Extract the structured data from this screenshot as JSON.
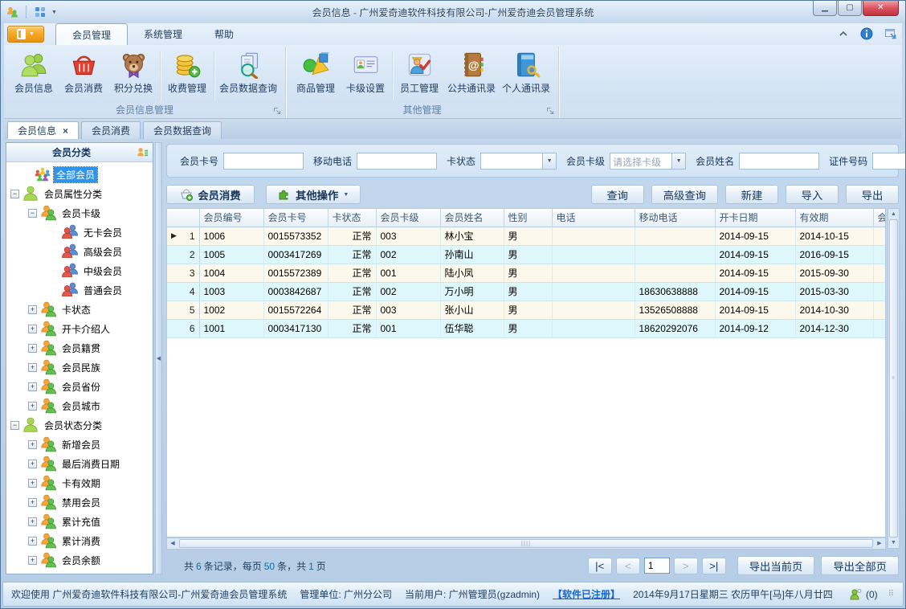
{
  "window": {
    "title": "会员信息 - 广州爱奇迪软件科技有限公司-广州爱奇迪会员管理系统"
  },
  "ribbon": {
    "tabs": [
      {
        "label": "会员管理"
      },
      {
        "label": "系统管理"
      },
      {
        "label": "帮助"
      }
    ],
    "groups": [
      {
        "label": "会员信息管理",
        "buttons": [
          {
            "label": "会员信息",
            "icon": "members-icon"
          },
          {
            "label": "会员消费",
            "icon": "basket-icon"
          },
          {
            "label": "积分兑换",
            "icon": "teddy-bear-icon"
          },
          {
            "label": "收费管理",
            "icon": "coins-add-icon"
          },
          {
            "label": "会员数据查询",
            "icon": "document-search-icon"
          }
        ]
      },
      {
        "label": "其他管理",
        "buttons": [
          {
            "label": "商品管理",
            "icon": "shapes-icon"
          },
          {
            "label": "卡级设置",
            "icon": "id-card-icon"
          },
          {
            "label": "员工管理",
            "icon": "staff-check-icon"
          },
          {
            "label": "公共通讯录",
            "icon": "address-book-icon"
          },
          {
            "label": "个人通讯录",
            "icon": "book-key-icon"
          }
        ]
      }
    ]
  },
  "doc_tabs": [
    {
      "label": "会员信息",
      "active": true
    },
    {
      "label": "会员消费"
    },
    {
      "label": "会员数据查询"
    }
  ],
  "sidebar": {
    "header": "会员分类",
    "tree": [
      {
        "label": "全部会员",
        "selected": true
      },
      {
        "label": "会员属性分类"
      },
      {
        "label": "会员卡级"
      },
      {
        "label": "无卡会员"
      },
      {
        "label": "高级会员"
      },
      {
        "label": "中级会员"
      },
      {
        "label": "普通会员"
      },
      {
        "label": "卡状态"
      },
      {
        "label": "开卡介绍人"
      },
      {
        "label": "会员籍贯"
      },
      {
        "label": "会员民族"
      },
      {
        "label": "会员省份"
      },
      {
        "label": "会员城市"
      },
      {
        "label": "会员状态分类"
      },
      {
        "label": "新增会员"
      },
      {
        "label": "最后消费日期"
      },
      {
        "label": "卡有效期"
      },
      {
        "label": "禁用会员"
      },
      {
        "label": "累计充值"
      },
      {
        "label": "累计消费"
      },
      {
        "label": "会员余额"
      }
    ]
  },
  "filters": {
    "card_no_label": "会员卡号",
    "mobile_label": "移动电话",
    "card_status_label": "卡状态",
    "card_level_label": "会员卡级",
    "card_level_placeholder": "请选择卡级",
    "name_label": "会员姓名",
    "id_no_label": "证件号码"
  },
  "actions": {
    "member_consume": "会员消费",
    "other_ops": "其他操作",
    "query": "查询",
    "advanced_query": "高级查询",
    "create": "新建",
    "import": "导入",
    "export": "导出"
  },
  "table": {
    "headers": [
      "",
      "会员编号",
      "会员卡号",
      "卡状态",
      "会员卡级",
      "会员姓名",
      "性别",
      "电话",
      "移动电话",
      "开卡日期",
      "有效期",
      "会员"
    ],
    "rows": [
      {
        "num": "1",
        "cells": [
          "1006",
          "0015573352",
          "正常",
          "003",
          "林小宝",
          "男",
          "",
          "",
          "2014-09-15",
          "2014-10-15",
          ""
        ]
      },
      {
        "num": "2",
        "cells": [
          "1005",
          "0003417269",
          "正常",
          "002",
          "孙南山",
          "男",
          "",
          "",
          "2014-09-15",
          "2016-09-15",
          ""
        ]
      },
      {
        "num": "3",
        "cells": [
          "1004",
          "0015572389",
          "正常",
          "001",
          "陆小凤",
          "男",
          "",
          "",
          "2014-09-15",
          "2015-09-30",
          ""
        ]
      },
      {
        "num": "4",
        "cells": [
          "1003",
          "0003842687",
          "正常",
          "002",
          "万小明",
          "男",
          "",
          "18630638888",
          "2014-09-15",
          "2015-03-30",
          ""
        ]
      },
      {
        "num": "5",
        "cells": [
          "1002",
          "0015572264",
          "正常",
          "003",
          "张小山",
          "男",
          "",
          "13526508888",
          "2014-09-15",
          "2014-10-30",
          ""
        ]
      },
      {
        "num": "6",
        "cells": [
          "1001",
          "0003417130",
          "正常",
          "001",
          "伍华聪",
          "男",
          "",
          "18620292076",
          "2014-09-12",
          "2014-12-30",
          ""
        ]
      }
    ]
  },
  "pager": {
    "summary": {
      "p1": "共",
      "count": "6",
      "p2": "条记录，每页",
      "size": "50",
      "p3": "条，共",
      "pages": "1",
      "p4": "页"
    },
    "first": "|<",
    "prev": "<",
    "page": "1",
    "next": ">",
    "last": ">|",
    "export_current": "导出当前页",
    "export_all": "导出全部页"
  },
  "status": {
    "welcome": "欢迎使用 广州爱奇迪软件科技有限公司-广州爱奇迪会员管理系统",
    "unit": "管理单位: 广州分公司",
    "user": "当前用户: 广州管理员(gzadmin)",
    "registered": "【软件已注册】",
    "date": "2014年9月17日星期三 农历甲午[马]年八月廿四",
    "messages": "(0)"
  },
  "colors": {
    "selection": "#2e95ef",
    "row_odd": "#fdf8ec",
    "row_even": "#def7fb",
    "accent_orange": "#f5a623",
    "link_blue": "#1464d2"
  }
}
